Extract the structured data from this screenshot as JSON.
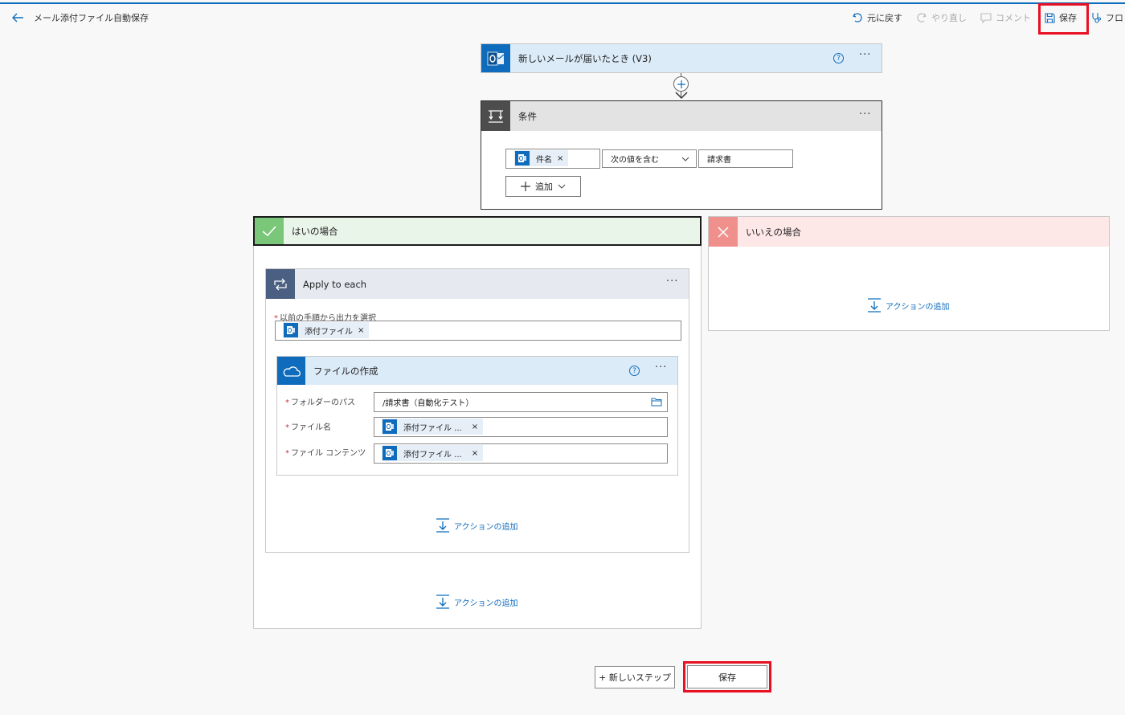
{
  "header": {
    "title": "メール添付ファイル自動保存",
    "undo_label": "元に戻す",
    "redo_label": "やり直し",
    "comment_label": "コメント",
    "save_label": "保存",
    "flow_label": "フロ"
  },
  "trigger": {
    "title": "新しいメールが届いたとき (V3)"
  },
  "condition": {
    "title": "条件",
    "token_label": "件名",
    "operator": "次の値を含む",
    "value": "請求書",
    "add_label": "追加"
  },
  "yes_branch": {
    "title": "はいの場合",
    "add_action_label": "アクションの追加",
    "apply_to_each": {
      "title": "Apply to each",
      "select_label": "以前の手順から出力を選択",
      "select_token": "添付ファイル",
      "add_action_label": "アクションの追加",
      "create_file": {
        "title": "ファイルの作成",
        "folder_label": "フォルダーのパス",
        "folder_value": "/請求書（自動化テスト）",
        "filename_label": "ファイル名",
        "filename_token": "添付ファイル ...",
        "content_label": "ファイル コンテンツ",
        "content_token": "添付ファイル ..."
      }
    }
  },
  "no_branch": {
    "title": "いいえの場合",
    "add_action_label": "アクションの追加"
  },
  "footer": {
    "new_step_label": "+ 新しいステップ",
    "save_label": "保存"
  },
  "colors": {
    "accent": "#0f6cbd",
    "highlight": "#e81123",
    "yes_header": "#eaf5ea",
    "yes_icon": "#7ac77a",
    "no_header": "#fde7e7",
    "no_icon": "#f0908c",
    "trigger_header": "#dcebf8",
    "condition_header": "#e3e3e3",
    "loop_header": "#e6eaf0",
    "loop_icon": "#4a5f82"
  }
}
